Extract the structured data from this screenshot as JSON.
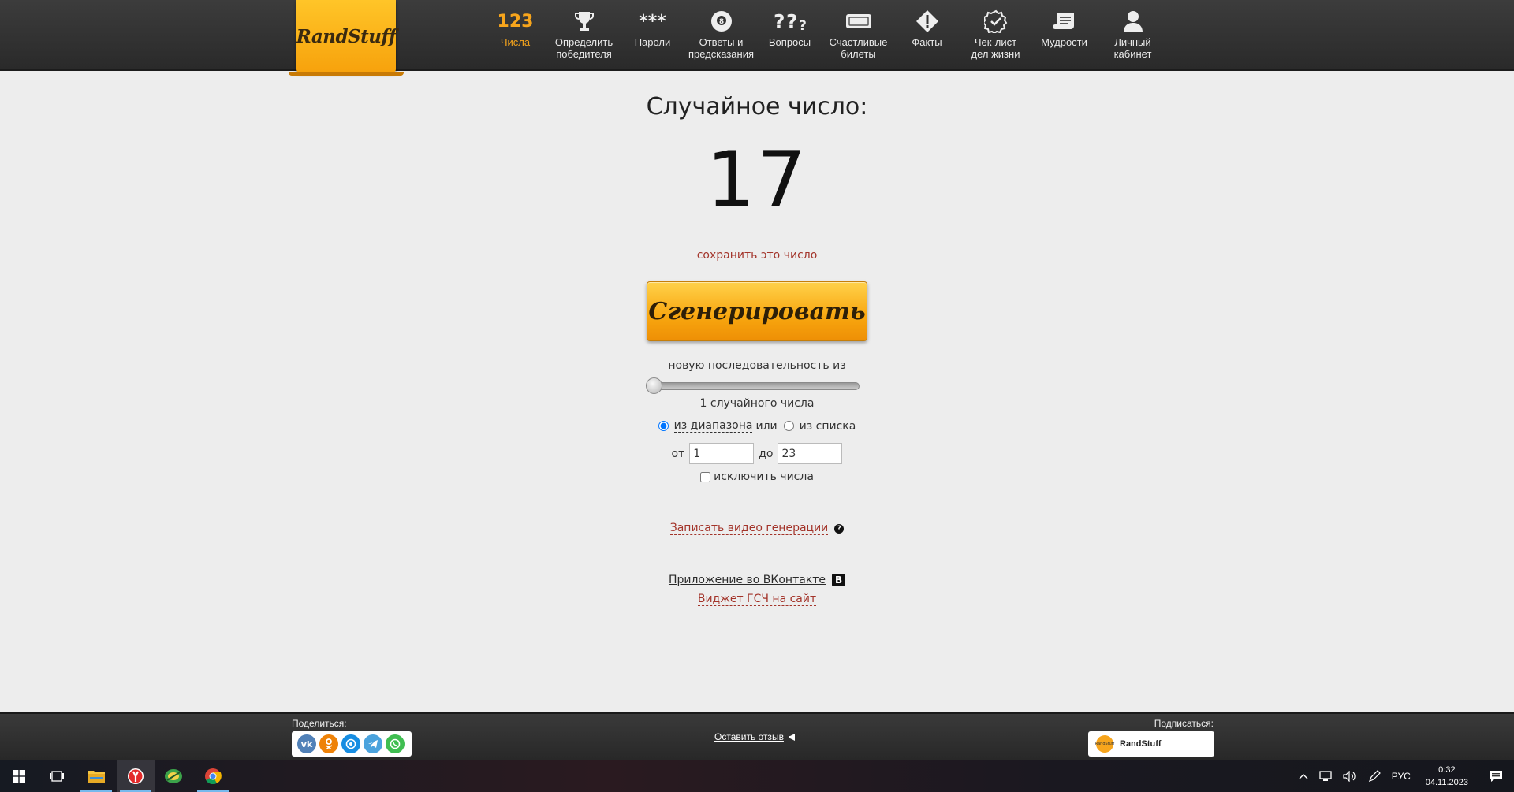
{
  "header": {
    "logo": "RandStuff",
    "nav": [
      {
        "icon": "123",
        "label": "Числа"
      },
      {
        "icon": "",
        "label": "Определить\nпобедителя"
      },
      {
        "icon": "***",
        "label": "Пароли"
      },
      {
        "icon": "",
        "label": "Ответы и\nпредсказания"
      },
      {
        "icon": "??? ",
        "label": "Вопросы"
      },
      {
        "icon": "",
        "label": "Счастливые\nбилеты"
      },
      {
        "icon": "",
        "label": "Факты"
      },
      {
        "icon": "",
        "label": "Чек-лист\nдел жизни"
      },
      {
        "icon": "",
        "label": "Мудрости"
      },
      {
        "icon": "",
        "label": "Личный\nкабинет"
      }
    ]
  },
  "main": {
    "title": "Случайное число:",
    "number": "17",
    "save_link": "сохранить это число",
    "generate_button": "Сгенерировать",
    "sequence_label": "новую последовательность из",
    "slider_value": 1,
    "count_label": "1 случайного числа",
    "radio_range": "из диапазона",
    "radio_or": "или",
    "radio_list": "из списка",
    "from_label": "от",
    "from_value": "1",
    "to_label": "до",
    "to_value": "23",
    "exclude_label": "исключить числа",
    "video_link": "Записать видео генерации",
    "help_icon": "?",
    "vk_app_link": "Приложение во ВКонтакте",
    "vk_badge": "B",
    "widget_link": "Виджет ГСЧ на сайт"
  },
  "footer": {
    "share_label": "Поделиться:",
    "feedback_link": "Оставить отзыв",
    "subscribe_label": "Подписаться:",
    "subscribe_name": "RandStuff",
    "subscribe_avatar": "RandStuff"
  },
  "taskbar": {
    "lang": "РУС",
    "time": "0:32",
    "date": "04.11.2023"
  },
  "colors": {
    "accent": "#f7a51c",
    "link_red": "#a3342a",
    "header_bg": "#333333"
  }
}
